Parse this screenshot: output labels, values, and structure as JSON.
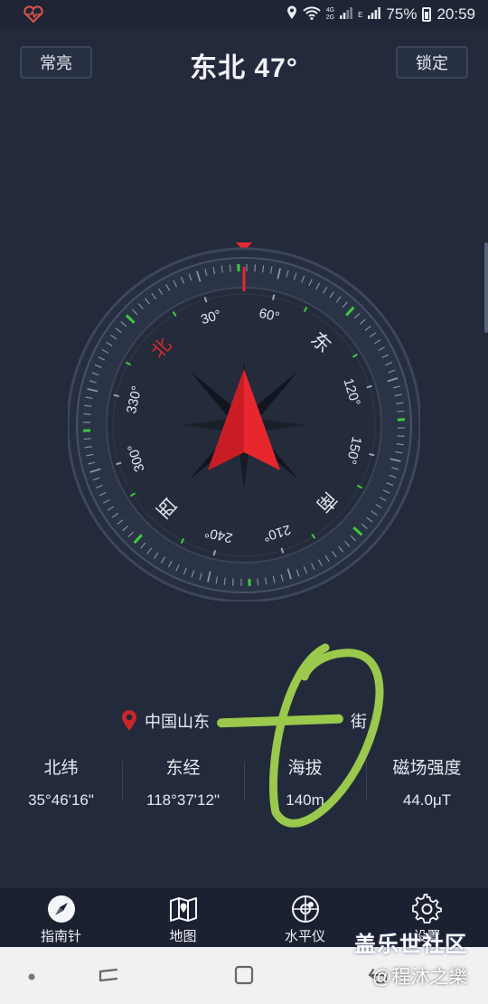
{
  "status_bar": {
    "battery": "75%",
    "time": "20:59",
    "net_small_1": "4G",
    "net_small_2": "2G",
    "net_small_3": "E"
  },
  "header": {
    "left_button": "常亮",
    "heading": "东北  47°",
    "right_button": "锁定"
  },
  "compass": {
    "heading_deg": 47,
    "degree_labels": [
      "30°",
      "60°",
      "120°",
      "150°",
      "210°",
      "240°",
      "300°",
      "330°"
    ],
    "cardinals": {
      "north": "北",
      "east": "东",
      "south": "南",
      "west": "西"
    },
    "colors": {
      "needle": "#e8262e",
      "north_label": "#d62b2b",
      "green_tick": "#3ec93c",
      "bezel": "#2c3446"
    }
  },
  "location": {
    "text_start": "中国山东",
    "text_end": "街"
  },
  "stats": [
    {
      "label": "北纬",
      "value": "35°46'16\""
    },
    {
      "label": "东经",
      "value": "118°37'12\""
    },
    {
      "label": "海拔",
      "value": "140m"
    },
    {
      "label": "磁场强度",
      "value": "44.0μT"
    }
  ],
  "bottom_nav": [
    {
      "label": "指南针",
      "icon": "compass-icon"
    },
    {
      "label": "地图",
      "icon": "map-icon"
    },
    {
      "label": "水平仪",
      "icon": "level-icon"
    },
    {
      "label": "设置",
      "icon": "gear-icon"
    }
  ],
  "watermark": {
    "line1": "盖乐世社区",
    "line2": "@程沐之樂"
  }
}
